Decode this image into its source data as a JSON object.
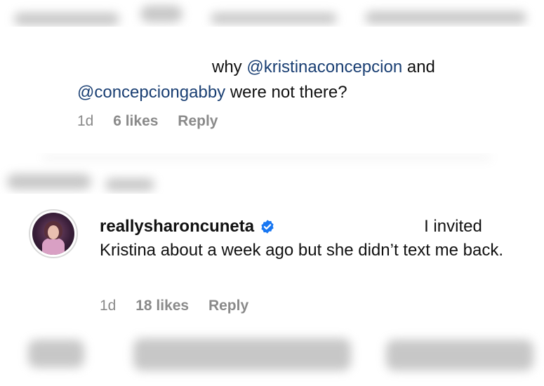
{
  "comment1": {
    "text_prefix": "why ",
    "mention1": "@kristinaconcepcion",
    "text_mid": " and",
    "mention2": "@concepciongabby",
    "text_suffix": " were not there?",
    "time": "1d",
    "likes": "6 likes",
    "reply": "Reply"
  },
  "comment2": {
    "username": "reallysharoncuneta",
    "text_line1": "I invited",
    "text_rest": "Kristina about a week ago but she didn’t text me back.",
    "time": "1d",
    "likes": "18 likes",
    "reply": "Reply",
    "avatar_icon": "profile-photo",
    "verified_icon": "verified-badge-icon"
  },
  "colors": {
    "mention": "#1a3f73",
    "meta": "#8a8a8a",
    "verified": "#1877f2"
  }
}
